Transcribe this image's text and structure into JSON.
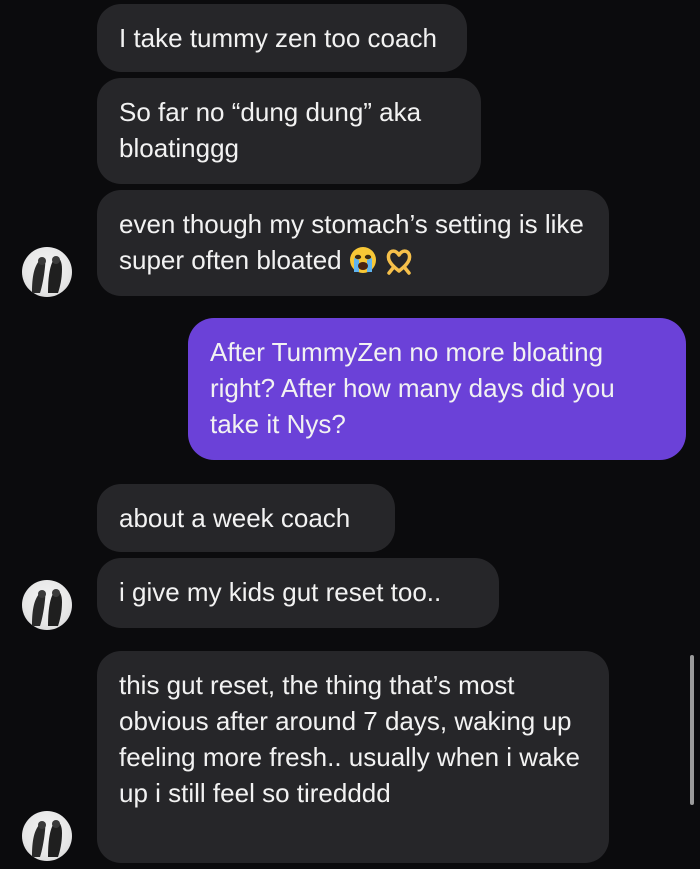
{
  "messages": [
    {
      "from": "them",
      "text": "I take tummy zen too coach"
    },
    {
      "from": "them",
      "text": "So far no “dung dung” aka bloatinggg"
    },
    {
      "from": "them",
      "text": "even though my stomach’s setting is like super often bloated",
      "emojis": [
        "crying-face-icon",
        "heart-hands-icon"
      ]
    },
    {
      "from": "me",
      "text": "After TummyZen no more bloating right? After how many days did you take it Nys?"
    },
    {
      "from": "them",
      "text": "about a week coach"
    },
    {
      "from": "them",
      "text": "i give my kids gut reset too.."
    },
    {
      "from": "them",
      "text": "this gut reset, the thing that’s most obvious after around 7 days, waking up feeling more fresh.. usually when i wake up i still feel so tiredddd"
    }
  ],
  "colors": {
    "background": "#0b0b0d",
    "incoming_bubble": "#262629",
    "outgoing_bubble": "#6b41d8",
    "text": "#f2f2f2"
  }
}
